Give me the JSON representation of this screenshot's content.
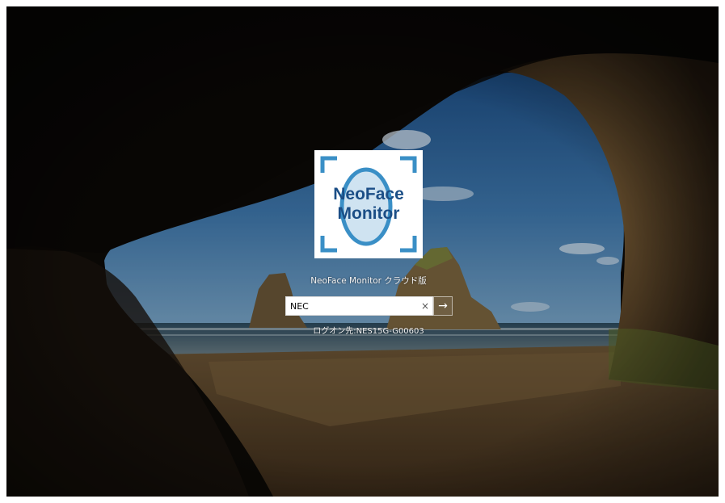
{
  "logo": {
    "line1": "NeoFace",
    "line2": "Monitor",
    "accent_color": "#3a8fc6",
    "text_color": "#1b4e86"
  },
  "account": {
    "display_name": "NeoFace Monitor クラウド版"
  },
  "password_field": {
    "value": "NEC",
    "clear_icon": "close-icon",
    "clear_glyph": "×",
    "submit_icon": "arrow-right-icon",
    "submit_glyph": "→"
  },
  "logon_target": {
    "text": "ログオン先:NES15G-G00603"
  }
}
